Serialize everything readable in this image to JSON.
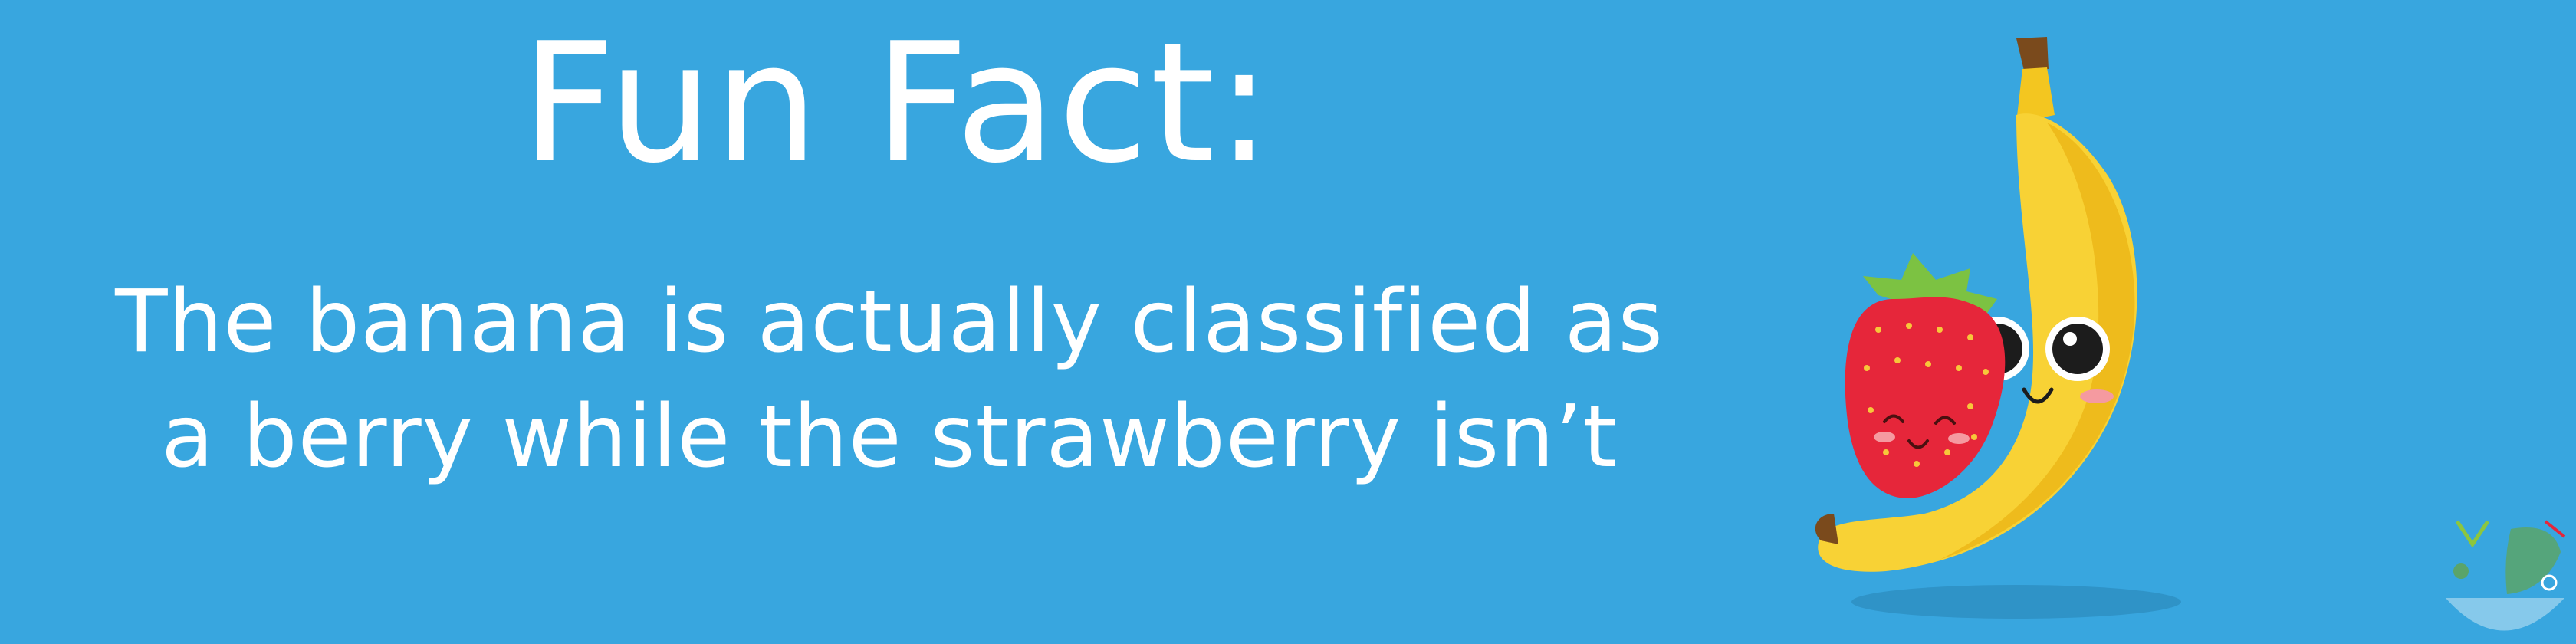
{
  "banner": {
    "title": "Fun Fact:",
    "fact_lines": [
      "The banana is actually classified as",
      "a berry while the strawberry isn’t"
    ]
  },
  "colors": {
    "background": "#38a6df",
    "text": "#ffffff",
    "banana": "#f8d235",
    "banana_shade": "#eebb1c",
    "strawberry": "#e6263a",
    "leaf": "#7cc242"
  },
  "icons": [
    "banana-icon",
    "strawberry-icon",
    "logo-bowl-icon"
  ]
}
